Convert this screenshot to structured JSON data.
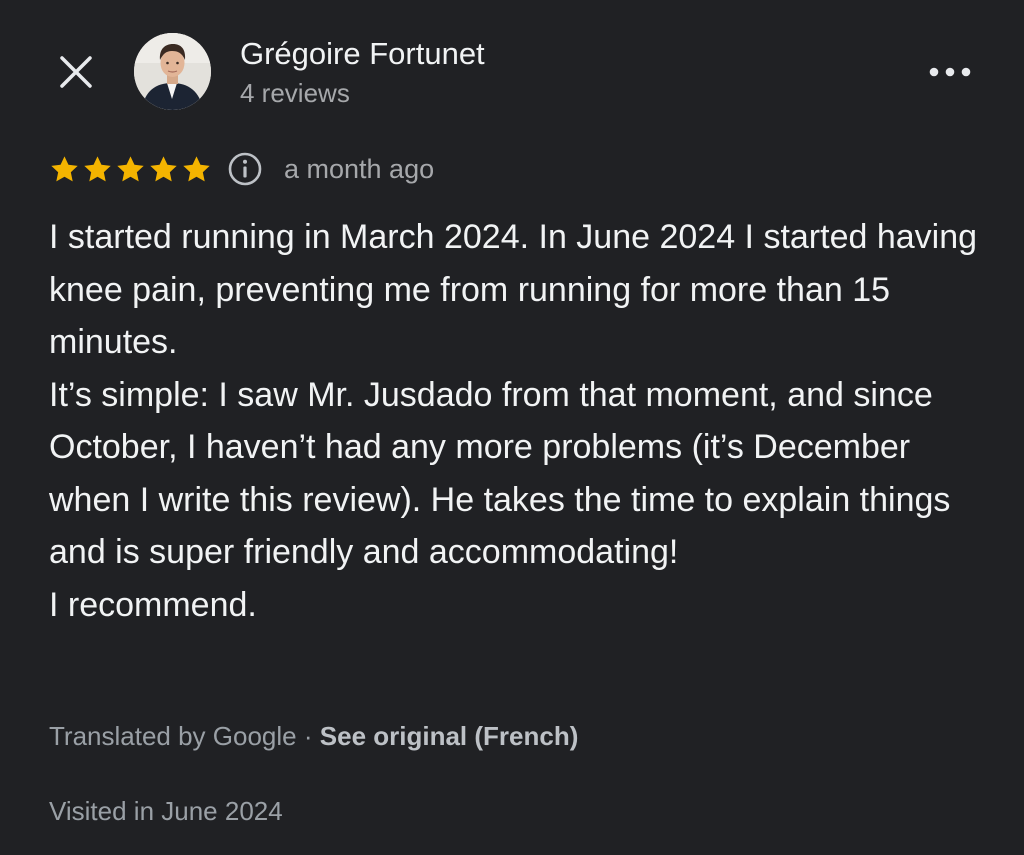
{
  "reviewer": {
    "name": "Grégoire Fortunet",
    "reviews_count": "4 reviews"
  },
  "icons": {
    "close": "close-icon",
    "avatar": "avatar-image",
    "more": "more-horizontal-icon",
    "info": "info-icon",
    "star": "star-icon"
  },
  "rating": {
    "stars": 5,
    "max": 5,
    "date": "a month ago",
    "star_color": "#f4b400"
  },
  "review": {
    "paragraphs": [
      "I started running in March 2024. In June 2024 I started having knee pain, preventing me from running for more than 15 minutes.",
      "It’s simple: I saw Mr. Jusdado from that moment, and since October, I haven’t had any more problems (it’s December when I write this review). He takes the time to explain things and is super friendly and accommodating!",
      "I recommend."
    ]
  },
  "translation": {
    "translated_by": "Translated by Google",
    "separator": "·",
    "see_original": "See original (French)"
  },
  "visited": "Visited in June 2024",
  "colors": {
    "background": "#202124",
    "text_primary": "#f1f3f4",
    "text_secondary": "#9aa0a6"
  }
}
